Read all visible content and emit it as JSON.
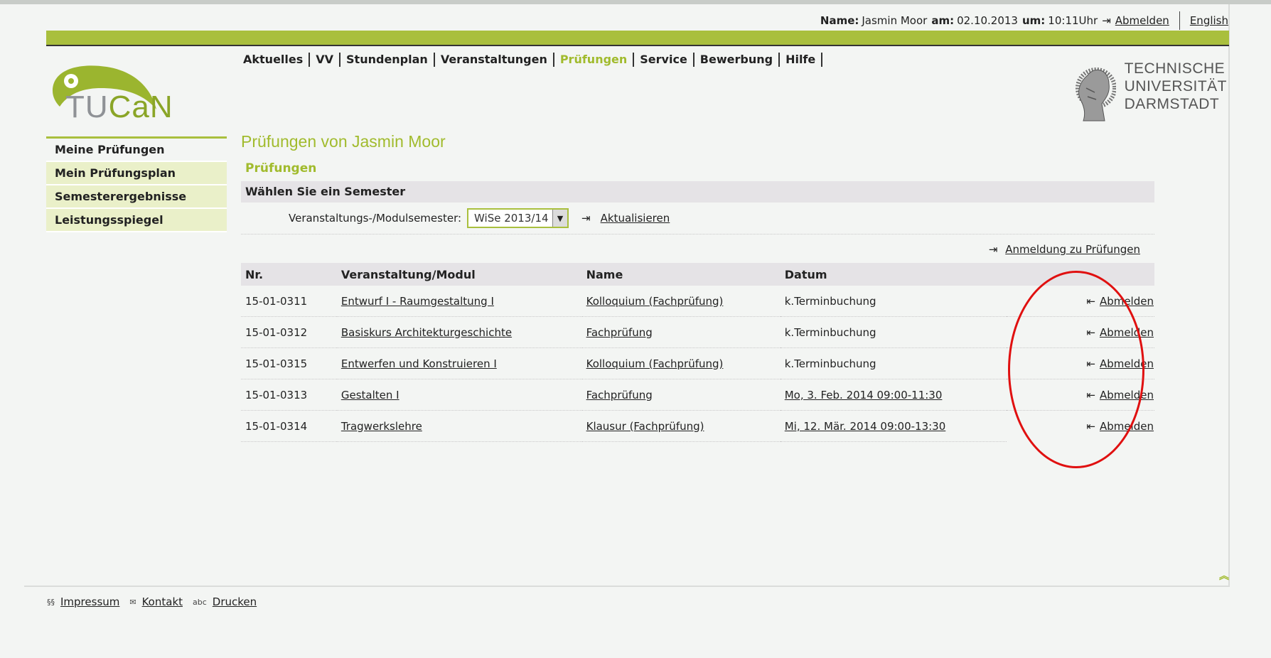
{
  "header": {
    "name_label": "Name:",
    "name_value": "Jasmin Moor",
    "date_label": "am:",
    "date_value": "02.10.2013",
    "time_label": "um:",
    "time_value": "10:11Uhr",
    "logout_label": "Abmelden",
    "language_label": "English"
  },
  "logo": {
    "text_tu": "TU",
    "text_can": "CaN"
  },
  "university": {
    "line1": "TECHNISCHE",
    "line2": "UNIVERSITÄT",
    "line3": "DARMSTADT"
  },
  "main_nav": [
    {
      "label": "Aktuelles"
    },
    {
      "label": "VV"
    },
    {
      "label": "Stundenplan"
    },
    {
      "label": "Veranstaltungen"
    },
    {
      "label": "Prüfungen",
      "active": true
    },
    {
      "label": "Service"
    },
    {
      "label": "Bewerbung"
    },
    {
      "label": "Hilfe"
    }
  ],
  "sidebar": {
    "items": [
      {
        "label": "Meine Prüfungen",
        "active": true
      },
      {
        "label": "Mein Prüfungsplan"
      },
      {
        "label": "Semesterergebnisse"
      },
      {
        "label": "Leistungsspiegel"
      }
    ]
  },
  "main": {
    "title": "Prüfungen von Jasmin Moor",
    "subtitle": "Prüfungen",
    "semester_heading": "Wählen Sie ein Semester",
    "semester_label": "Veranstaltungs-/Modulsemester:",
    "semester_selected": "WiSe 2013/14",
    "refresh_label": "Aktualisieren",
    "register_label": "Anmeldung zu Prüfungen",
    "table": {
      "headers": [
        "Nr.",
        "Veranstaltung/Modul",
        "Name",
        "Datum",
        ""
      ],
      "rows": [
        {
          "nr": "15-01-0311",
          "modul": "Entwurf I - Raumgestaltung I",
          "name": "Kolloquium (Fachprüfung)",
          "datum": "k.Terminbuchung",
          "action": "Abmelden"
        },
        {
          "nr": "15-01-0312",
          "modul": "Basiskurs Architekturgeschichte",
          "name": "Fachprüfung",
          "datum": "k.Terminbuchung",
          "action": "Abmelden"
        },
        {
          "nr": "15-01-0315",
          "modul": "Entwerfen und Konstruieren I",
          "name": "Kolloquium (Fachprüfung)",
          "datum": "k.Terminbuchung",
          "action": "Abmelden"
        },
        {
          "nr": "15-01-0313",
          "modul": "Gestalten I",
          "name": "Fachprüfung",
          "datum": "Mo, 3. Feb. 2014 09:00-11:30",
          "action": "Abmelden"
        },
        {
          "nr": "15-01-0314",
          "modul": "Tragwerkslehre",
          "name": "Klausur (Fachprüfung)",
          "datum": "Mi, 12. Mär. 2014 09:00-13:30",
          "action": "Abmelden"
        }
      ]
    }
  },
  "footer": {
    "impressum": "Impressum",
    "kontakt": "Kontakt",
    "drucken": "Drucken",
    "impressum_icon_text": "§§",
    "drucken_icon_text": "abc"
  },
  "colors": {
    "accent": "#a9bf3d",
    "highlight_circle": "#e01010"
  }
}
